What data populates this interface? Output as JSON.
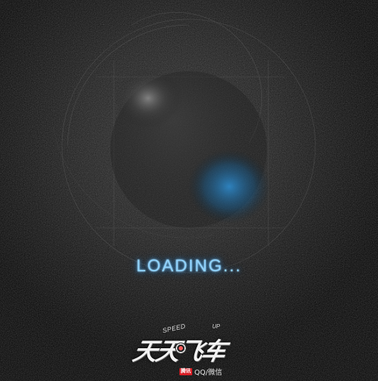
{
  "loading": {
    "label": "LOADING..."
  },
  "logo": {
    "title": "天天飞车",
    "tagline_1": "SPEED",
    "tagline_2": "UP",
    "publisher_badge": "腾讯",
    "platform_text": "QQ/微信"
  },
  "colors": {
    "accent": "#2f8fd8",
    "loading_text": "#8fd3ff",
    "badge_red": "#d91f26"
  }
}
